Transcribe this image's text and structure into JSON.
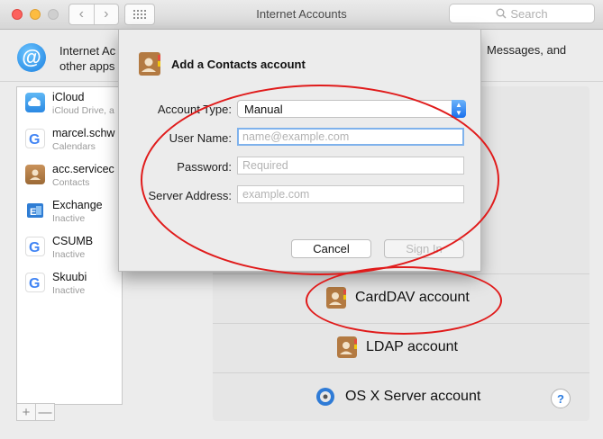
{
  "window": {
    "title": "Internet Accounts",
    "search_placeholder": "Search"
  },
  "nav": {
    "back": "‹",
    "forward": "›"
  },
  "header": {
    "icon": "at-icon",
    "text_line1": "Internet Ac",
    "text_line2": "other apps",
    "text_right": "Messages, and"
  },
  "sidebar": {
    "items": [
      {
        "name": "iCloud",
        "subtitle": "iCloud Drive, a",
        "icon": "icloud-icon"
      },
      {
        "name": "marcel.schw",
        "subtitle": "Calendars",
        "icon": "google-icon"
      },
      {
        "name": "acc.servicec",
        "subtitle": "Contacts",
        "icon": "contacts-icon"
      },
      {
        "name": "Exchange",
        "subtitle": "Inactive",
        "icon": "exchange-icon"
      },
      {
        "name": "CSUMB",
        "subtitle": "Inactive",
        "icon": "google-icon"
      },
      {
        "name": "Skuubi",
        "subtitle": "Inactive",
        "icon": "google-icon"
      }
    ],
    "add_label": "+",
    "remove_label": "—"
  },
  "providers": {
    "carddav": "CardDAV account",
    "ldap": "LDAP account",
    "osx_server": "OS X Server account"
  },
  "help_label": "?",
  "sheet": {
    "title": "Add a Contacts account",
    "account_type_label": "Account Type:",
    "account_type_value": "Manual",
    "user_name_label": "User Name:",
    "user_name_placeholder": "name@example.com",
    "password_label": "Password:",
    "password_placeholder": "Required",
    "server_label": "Server Address:",
    "server_placeholder": "example.com",
    "cancel_label": "Cancel",
    "signin_label": "Sign In"
  },
  "colors": {
    "accent": "#1970ed",
    "annotation": "#e01b1b"
  }
}
